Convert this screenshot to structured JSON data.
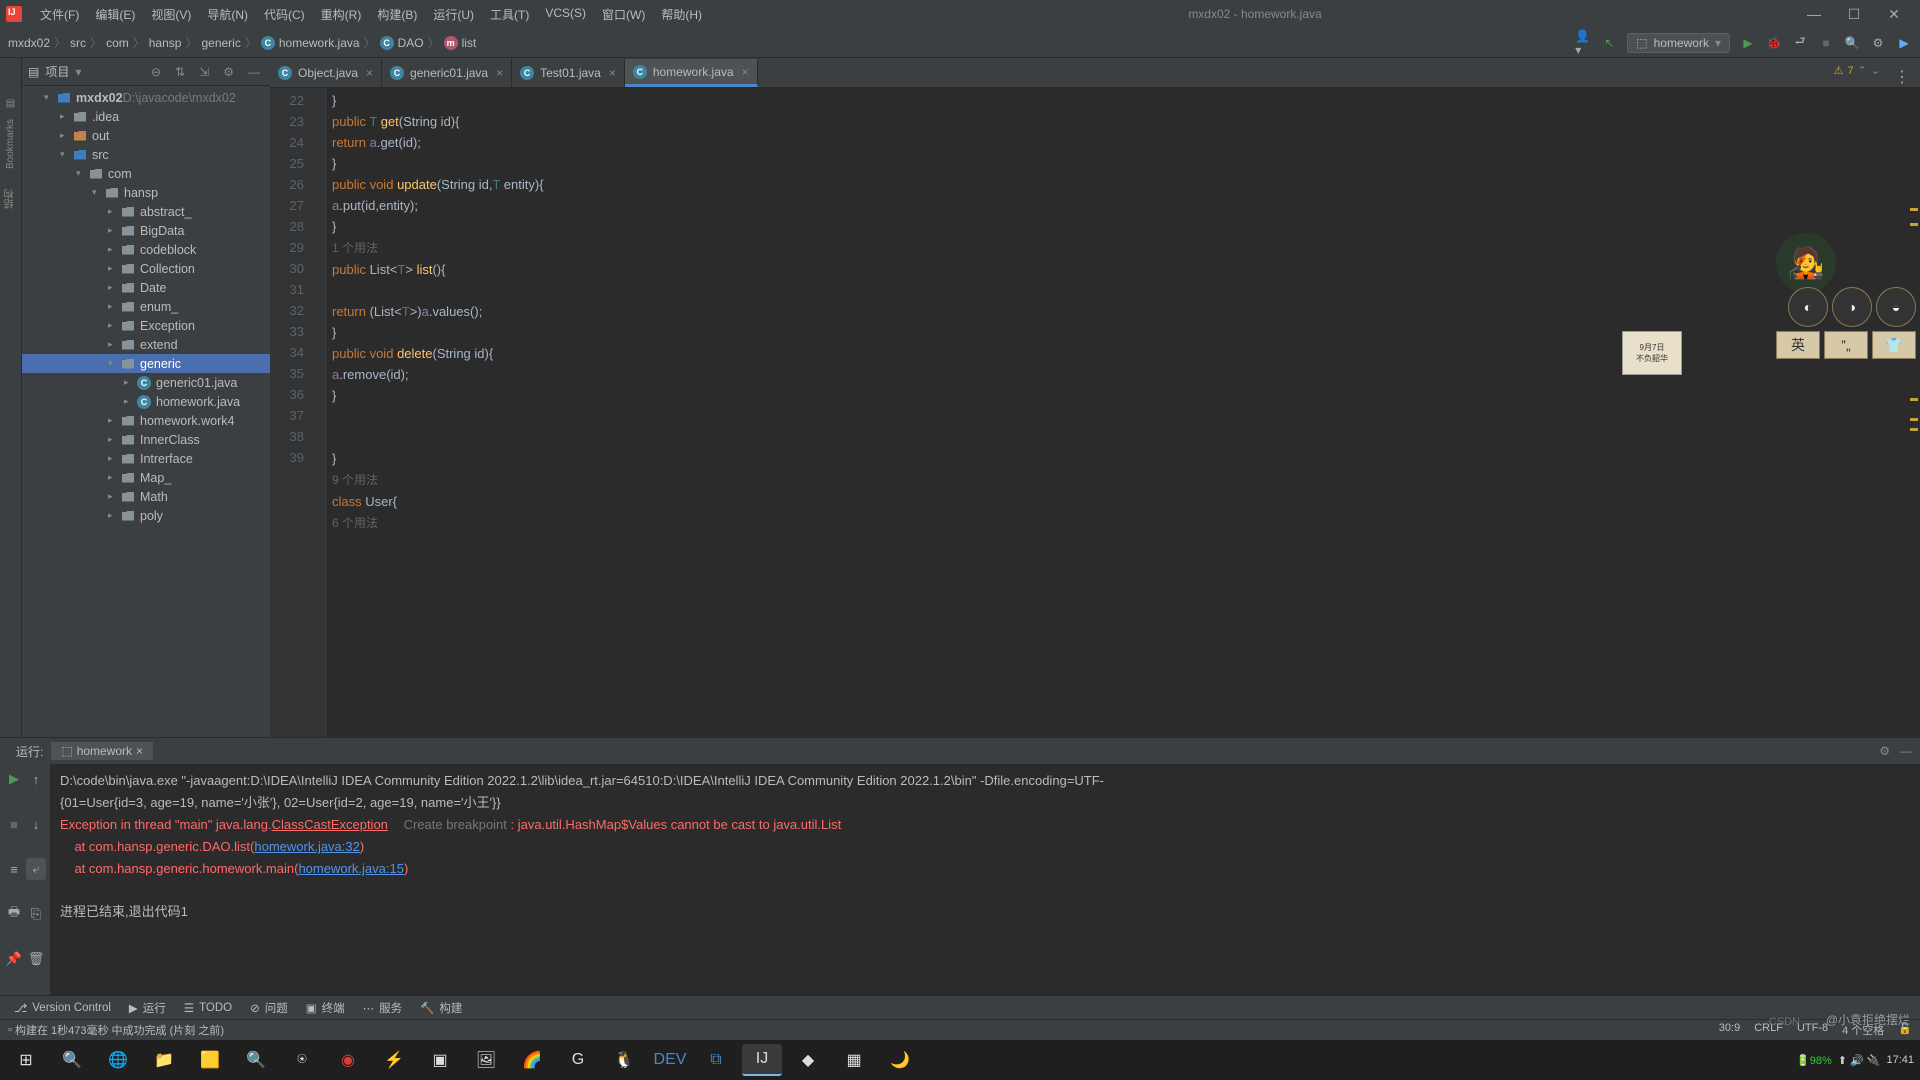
{
  "window": {
    "title": "mxdx02 - homework.java"
  },
  "menu": [
    "文件(F)",
    "编辑(E)",
    "视图(V)",
    "导航(N)",
    "代码(C)",
    "重构(R)",
    "构建(B)",
    "运行(U)",
    "工具(T)",
    "VCS(S)",
    "窗口(W)",
    "帮助(H)"
  ],
  "breadcrumb": [
    "mxdx02",
    "src",
    "com",
    "hansp",
    "generic",
    "homework.java",
    "DAO",
    "list"
  ],
  "runconfig": "homework",
  "project": {
    "label": "项目",
    "root": "mxdx02",
    "root_hint": "D:\\javacode\\mxdx02"
  },
  "tree": [
    {
      "d": 1,
      "a": "▾",
      "t": "mxdx02",
      "hint": "D:\\javacode\\mxdx02",
      "ic": "fold bl",
      "bold": true
    },
    {
      "d": 2,
      "a": "▸",
      "t": ".idea",
      "ic": "fold"
    },
    {
      "d": 2,
      "a": "▸",
      "t": "out",
      "ic": "fold or"
    },
    {
      "d": 2,
      "a": "▾",
      "t": "src",
      "ic": "fold bl"
    },
    {
      "d": 3,
      "a": "▾",
      "t": "com",
      "ic": "fold"
    },
    {
      "d": 4,
      "a": "▾",
      "t": "hansp",
      "ic": "fold"
    },
    {
      "d": 5,
      "a": "▸",
      "t": "abstract_",
      "ic": "fold"
    },
    {
      "d": 5,
      "a": "▸",
      "t": "BigData",
      "ic": "fold"
    },
    {
      "d": 5,
      "a": "▸",
      "t": "codeblock",
      "ic": "fold"
    },
    {
      "d": 5,
      "a": "▸",
      "t": "Collection",
      "ic": "fold"
    },
    {
      "d": 5,
      "a": "▸",
      "t": "Date",
      "ic": "fold"
    },
    {
      "d": 5,
      "a": "▸",
      "t": "enum_",
      "ic": "fold"
    },
    {
      "d": 5,
      "a": "▸",
      "t": "Exception",
      "ic": "fold"
    },
    {
      "d": 5,
      "a": "▸",
      "t": "extend",
      "ic": "fold"
    },
    {
      "d": 5,
      "a": "▾",
      "t": "generic",
      "ic": "fold",
      "sel": "active"
    },
    {
      "d": 6,
      "a": "▸",
      "t": "generic01.java",
      "ic": "j"
    },
    {
      "d": 6,
      "a": "▸",
      "t": "homework.java",
      "ic": "j"
    },
    {
      "d": 5,
      "a": "▸",
      "t": "homework.work4",
      "ic": "fold"
    },
    {
      "d": 5,
      "a": "▸",
      "t": "InnerClass",
      "ic": "fold"
    },
    {
      "d": 5,
      "a": "▸",
      "t": "Intrerface",
      "ic": "fold"
    },
    {
      "d": 5,
      "a": "▸",
      "t": "Map_",
      "ic": "fold"
    },
    {
      "d": 5,
      "a": "▸",
      "t": "Math",
      "ic": "fold"
    },
    {
      "d": 5,
      "a": "▸",
      "t": "poly",
      "ic": "fold"
    }
  ],
  "tabs": [
    {
      "name": "Object.java"
    },
    {
      "name": "generic01.java"
    },
    {
      "name": "Test01.java"
    },
    {
      "name": "homework.java",
      "active": true
    }
  ],
  "warn_count": "7",
  "code_lines": [
    {
      "n": "22",
      "h": "        }"
    },
    {
      "n": "23",
      "h": "        <kw>public</kw> <ty>T</ty> <fn>get</fn>(String id){"
    },
    {
      "n": "24",
      "h": "            <kw>return</kw> <id>a</id>.get(id);"
    },
    {
      "n": "25",
      "h": "        }"
    },
    {
      "n": "26",
      "h": "        <kw>public void</kw> <fn>update</fn>(String id,<ty>T</ty> entity){"
    },
    {
      "n": "27",
      "h": "        <id>a</id>.put(id,entity);"
    },
    {
      "n": "28",
      "h": "        }"
    },
    {
      "n": "",
      "h": "        <hint>1 个用法</hint>"
    },
    {
      "n": "29",
      "h": "        <kw>public</kw> List&lt;<ty>T</ty>&gt; <fn>list</fn>(){"
    },
    {
      "n": "30",
      "h": ""
    },
    {
      "n": "31",
      "h": "            <kw>return</kw> (List&lt;<ty>T</ty>&gt;)<id>a</id>.values();"
    },
    {
      "n": "32",
      "h": "        }"
    },
    {
      "n": "33",
      "h": "        <kw>public void</kw> <fn>delete</fn>(String id){"
    },
    {
      "n": "34",
      "h": "        <id>a</id>.remove(id);"
    },
    {
      "n": "35",
      "h": "        }"
    },
    {
      "n": "36",
      "h": ""
    },
    {
      "n": "37",
      "h": ""
    },
    {
      "n": "38",
      "h": "}"
    },
    {
      "n": "",
      "h": "<hint>9 个用法</hint>"
    },
    {
      "n": "39",
      "h": "<kw>class</kw> User{"
    },
    {
      "n": "",
      "h": "    <hint>6 个用法</hint>"
    }
  ],
  "run_panel": {
    "label": "运行:",
    "tab": "homework"
  },
  "console": {
    "l1": "D:\\code\\bin\\java.exe \"-javaagent:D:\\IDEA\\IntelliJ IDEA Community Edition 2022.1.2\\lib\\idea_rt.jar=64510:D:\\IDEA\\IntelliJ IDEA Community Edition 2022.1.2\\bin\" -Dfile.encoding=UTF-",
    "l2": "{01=User{id=3, age=19, name='小张'}, 02=User{id=2, age=19, name='小王'}}",
    "l3a": "Exception in thread \"main\" java.lang.",
    "l3b": "ClassCastException",
    "l3c": "Create breakpoint",
    "l3d": " : java.util.HashMap$Values cannot be cast to java.util.List",
    "l4a": "    at com.hansp.generic.DAO.list(",
    "l4b": "homework.java:32",
    "l4c": ")",
    "l5a": "    at com.hansp.generic.homework.main(",
    "l5b": "homework.java:15",
    "l5c": ")",
    "l7": "进程已结束,退出代码1"
  },
  "bottom_tools": [
    {
      "i": "⎇",
      "t": "Version Control"
    },
    {
      "i": "▶",
      "t": "运行"
    },
    {
      "i": "☰",
      "t": "TODO"
    },
    {
      "i": "⊘",
      "t": "问题"
    },
    {
      "i": "▣",
      "t": "终端"
    },
    {
      "i": "⋯",
      "t": "服务"
    },
    {
      "i": "🔨",
      "t": "构建"
    }
  ],
  "status": {
    "left": "构建在 1秒473毫秒 中成功完成 (片刻 之前)",
    "caret": "30:9",
    "eol": "CRLF",
    "enc": "UTF-8",
    "indent": "4 个空格"
  },
  "watermark": "@小袁拒绝摆烂",
  "watermark2": "CSDN",
  "tray": {
    "time": "17:41"
  },
  "calendar": {
    "l1": "9月7日",
    "l2": "不负韶华"
  }
}
